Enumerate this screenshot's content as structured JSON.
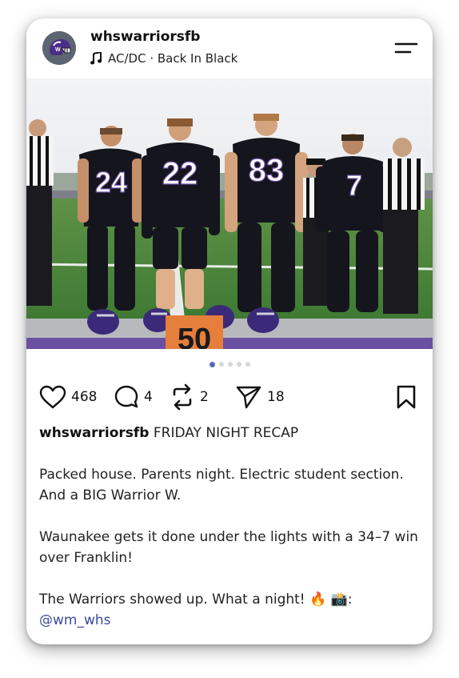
{
  "post": {
    "username": "whswarriorsfb",
    "music": "AC/DC · Back In Black",
    "image": {
      "jersey_numbers": [
        "24",
        "22",
        "83",
        "7"
      ],
      "yard_marker": "50"
    },
    "carousel": {
      "count": 5,
      "active": 0
    },
    "actions": {
      "likes": "468",
      "comments": "4",
      "reposts": "2",
      "shares": "18"
    },
    "caption": {
      "username": "whswarriorsfb",
      "title": " FRIDAY NIGHT RECAP",
      "paragraph_1": "Packed house. Parents night. Electric student section. And a BIG Warrior W.",
      "paragraph_2": "Waunakee gets it done under the lights with a 34–7 win over Franklin!",
      "paragraph_3": "The Warriors showed up. What a night! 🔥 📸:",
      "mention": "@wm_whs"
    }
  },
  "colors": {
    "accent": "#5968b8",
    "mention": "#3b4aa0",
    "jersey": "#15151e",
    "turf": "#4d8a3c",
    "purple_line": "#6a4fa3"
  },
  "icons": {
    "music": "music-note-icon",
    "menu": "menu-icon",
    "like": "heart-icon",
    "comment": "comment-icon",
    "repost": "repost-icon",
    "share": "send-icon",
    "save": "bookmark-icon"
  }
}
